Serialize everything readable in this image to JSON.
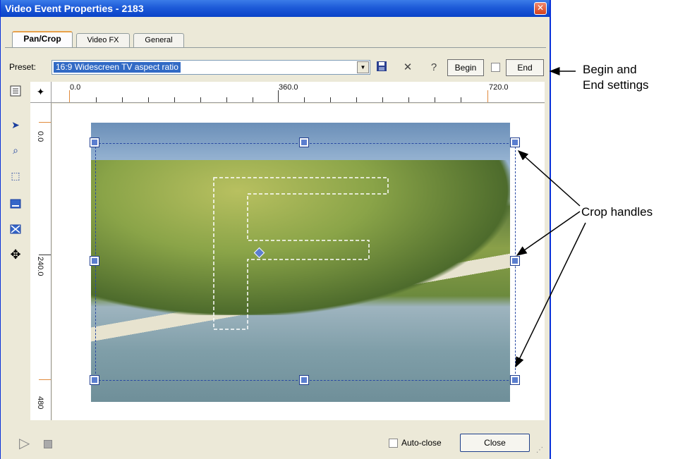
{
  "window": {
    "title": "Video Event Properties - 2183",
    "close_glyph": "✕"
  },
  "tabs": [
    {
      "label": "Pan/Crop",
      "active": true
    },
    {
      "label": "Video FX",
      "active": false
    },
    {
      "label": "General",
      "active": false
    }
  ],
  "toolbar": {
    "preset_label": "Preset:",
    "preset_value": "16:9 Widescreen TV aspect ratio",
    "save_icon": "save-icon",
    "delete_icon": "delete-icon",
    "help_icon": "help-icon",
    "begin_label": "Begin",
    "end_label": "End"
  },
  "left_tools": [
    "properties-icon",
    "pointer-icon",
    "zoom-icon",
    "select-icon",
    "fit-icon",
    "crop-icon",
    "move-icon"
  ],
  "ruler": {
    "top_labels": [
      "0.0",
      "360.0",
      "720.0"
    ],
    "left_labels": [
      "0.0",
      "240.0",
      "480"
    ]
  },
  "footer": {
    "autoclose_label": "Auto-close",
    "close_button": "Close"
  },
  "callouts": {
    "begin_end": [
      "Begin and",
      "End settings"
    ],
    "crop_handles": "Crop handles"
  },
  "colors": {
    "title_bar": "#1d5ad8",
    "crop_handle": "#5b7ecf",
    "selection": "#316ac5"
  }
}
